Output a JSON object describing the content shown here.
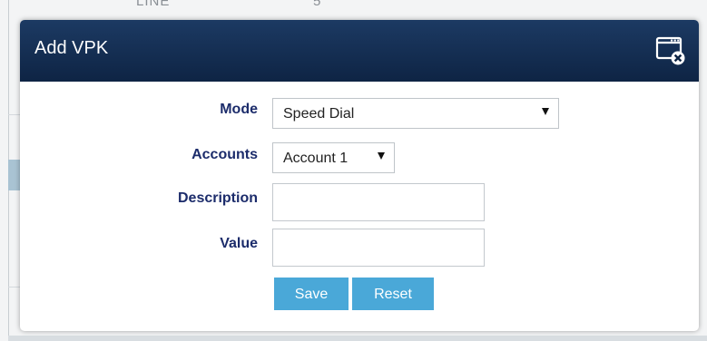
{
  "background": {
    "line_label": "LINE",
    "line_value": "5"
  },
  "modal": {
    "title": "Add VPK",
    "close_icon": "window-close-icon",
    "header_color": "#0e2444"
  },
  "form": {
    "mode": {
      "label": "Mode",
      "selected": "Speed Dial"
    },
    "accounts": {
      "label": "Accounts",
      "selected": "Account 1"
    },
    "description": {
      "label": "Description",
      "value": ""
    },
    "value": {
      "label": "Value",
      "value": ""
    }
  },
  "buttons": {
    "save_label": "Save",
    "reset_label": "Reset",
    "color": "#4aa8d8"
  }
}
